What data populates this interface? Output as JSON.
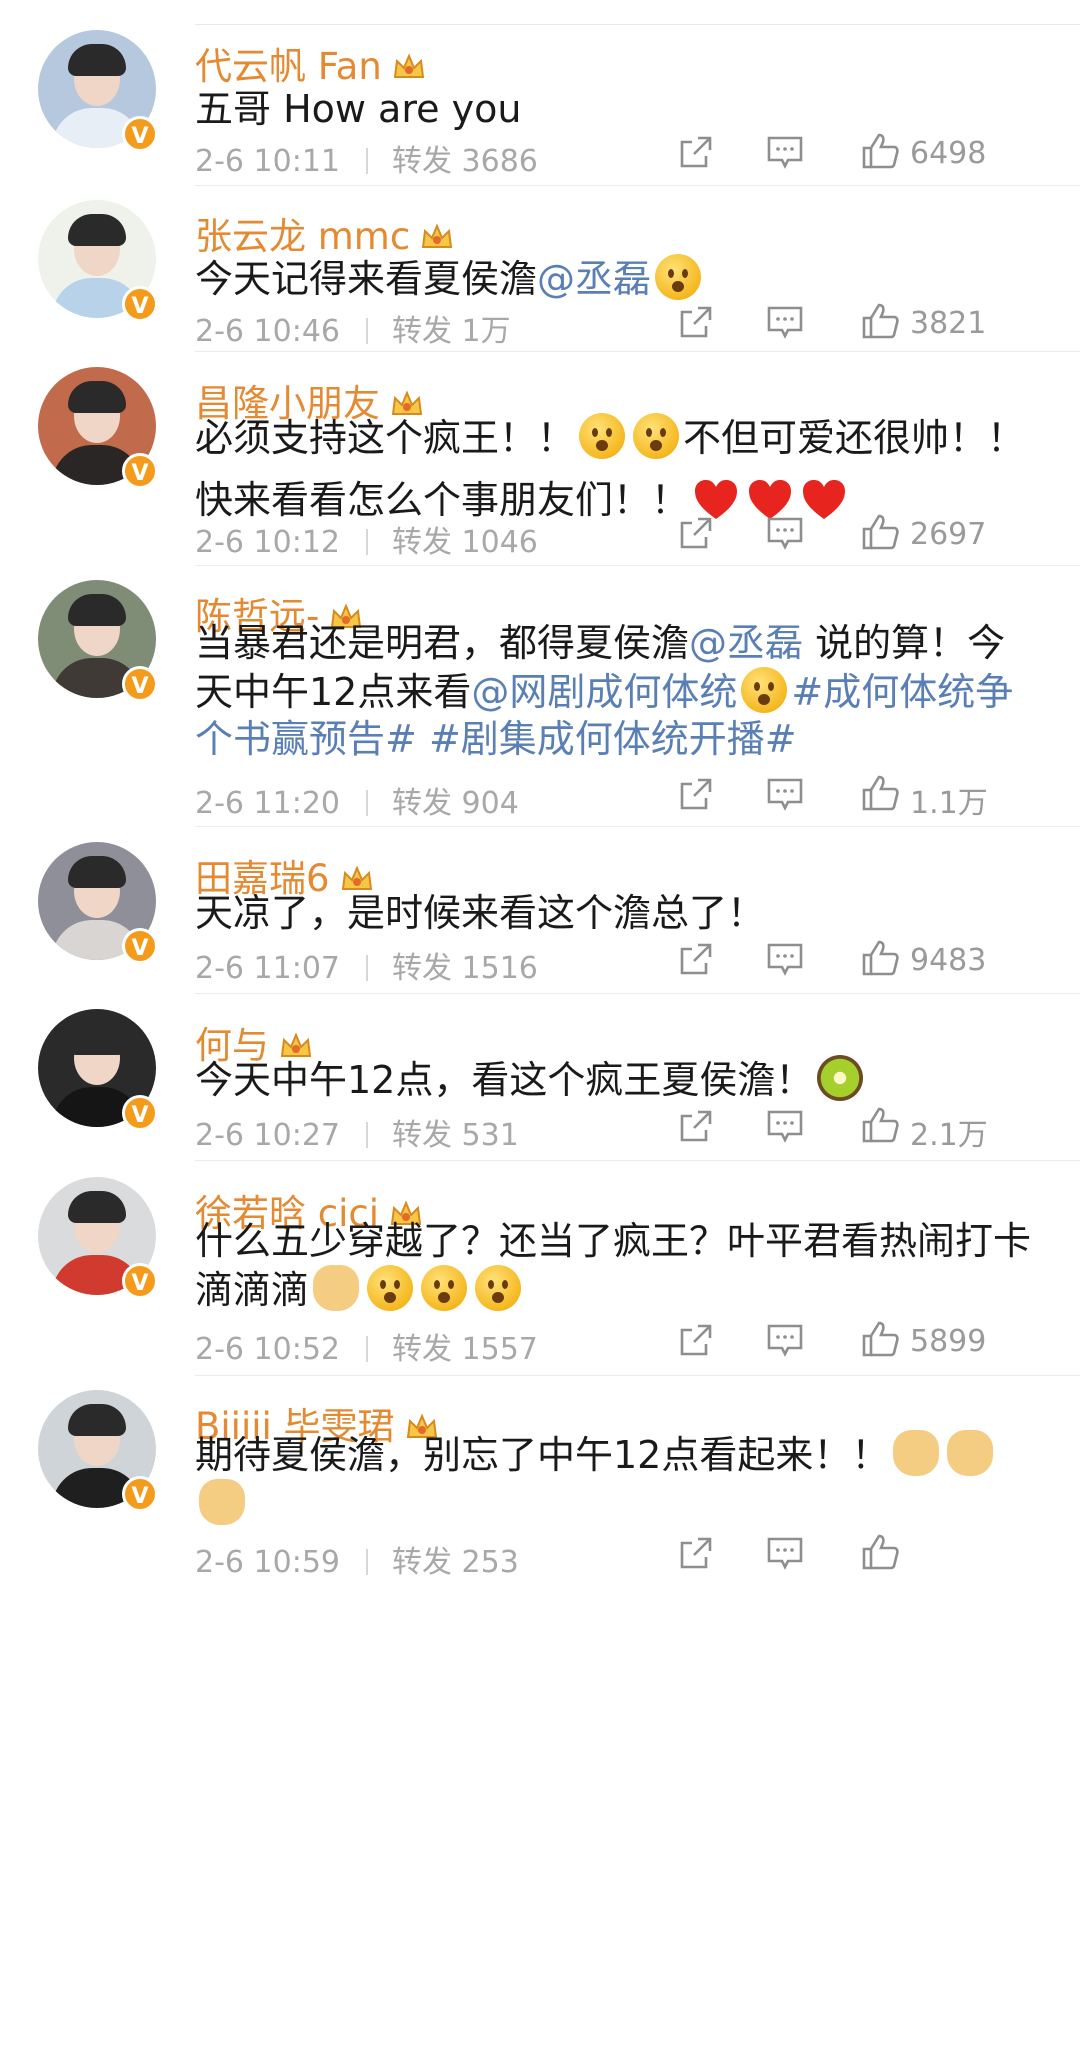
{
  "comments": [
    {
      "username": "代云帆 Fan",
      "segments": [
        {
          "text": "五哥  How are you"
        }
      ],
      "time": "2-6 10:11",
      "repost_label": "转发",
      "reposts": "3686",
      "likes": "6498"
    },
    {
      "username": "张云龙 mmc",
      "segments": [
        {
          "text": "今天记得来看夏侯澹"
        },
        {
          "text": "@丞磊",
          "type": "mention"
        },
        {
          "emoji": "smile-hand"
        }
      ],
      "time": "2-6 10:46",
      "repost_label": "转发",
      "reposts": "1万",
      "likes": "3821"
    },
    {
      "username": "昌隆小朋友",
      "segments": [
        {
          "text": "必须支持这个疯王！！"
        },
        {
          "emoji": "wave-guy"
        },
        {
          "emoji": "wave-guy"
        },
        {
          "text": "不但可爱还很帅！！快来看看怎么个事朋友们！！"
        },
        {
          "emoji": "heart"
        },
        {
          "emoji": "heart"
        },
        {
          "emoji": "heart"
        }
      ],
      "time": "2-6 10:12",
      "repost_label": "转发",
      "reposts": "1046",
      "likes": "2697"
    },
    {
      "username": "陈哲远-",
      "segments": [
        {
          "text": "当暴君还是明君，都得夏侯澹"
        },
        {
          "text": "@丞磊",
          "type": "mention"
        },
        {
          "text": " 说的算！今天中午12点来看"
        },
        {
          "text": "@网剧成何体统",
          "type": "mention"
        },
        {
          "emoji": "laugh-sweat"
        },
        {
          "text": "#成何体统争个书赢预告#",
          "type": "tag"
        },
        {
          "text": " "
        },
        {
          "text": "#剧集成何体统开播#",
          "type": "tag"
        }
      ],
      "time": "2-6 11:20",
      "repost_label": "转发",
      "reposts": "904",
      "likes": "1.1万"
    },
    {
      "username": "田嘉瑞6",
      "segments": [
        {
          "text": "天凉了，是时候来看这个澹总了！"
        }
      ],
      "time": "2-6 11:07",
      "repost_label": "转发",
      "reposts": "1516",
      "likes": "9483"
    },
    {
      "username": "何与",
      "segments": [
        {
          "text": "今天中午12点，看这个疯王夏侯澹！"
        },
        {
          "emoji": "kiwi"
        }
      ],
      "time": "2-6 10:27",
      "repost_label": "转发",
      "reposts": "531",
      "likes": "2.1万"
    },
    {
      "username": "徐若晗 cici",
      "segments": [
        {
          "text": "什么五少穿越了？还当了疯王？叶平君看热闹打卡滴滴滴"
        },
        {
          "emoji": "clap"
        },
        {
          "emoji": "surprised"
        },
        {
          "emoji": "surprised"
        },
        {
          "emoji": "surprised"
        }
      ],
      "time": "2-6 10:52",
      "repost_label": "转发",
      "reposts": "1557",
      "likes": "5899"
    },
    {
      "username": "Biiiii 毕雯珺",
      "segments": [
        {
          "text": "期待夏侯澹，别忘了中午12点看起来！！"
        },
        {
          "emoji": "rock-hand"
        },
        {
          "emoji": "rock-hand"
        },
        {
          "emoji": "rock-hand"
        }
      ],
      "time": "2-6 10:59",
      "repost_label": "转发",
      "reposts": "253",
      "likes": ""
    }
  ],
  "icons": {
    "verified_badge": "V",
    "crown": "vip-crown-icon",
    "share": "share-icon",
    "comment": "comment-icon",
    "like": "thumbs-up-icon"
  },
  "colors": {
    "username": "#e38a32",
    "link": "#5a7fb5",
    "meta": "#a8a8a8",
    "verified": "#f59b1b"
  }
}
